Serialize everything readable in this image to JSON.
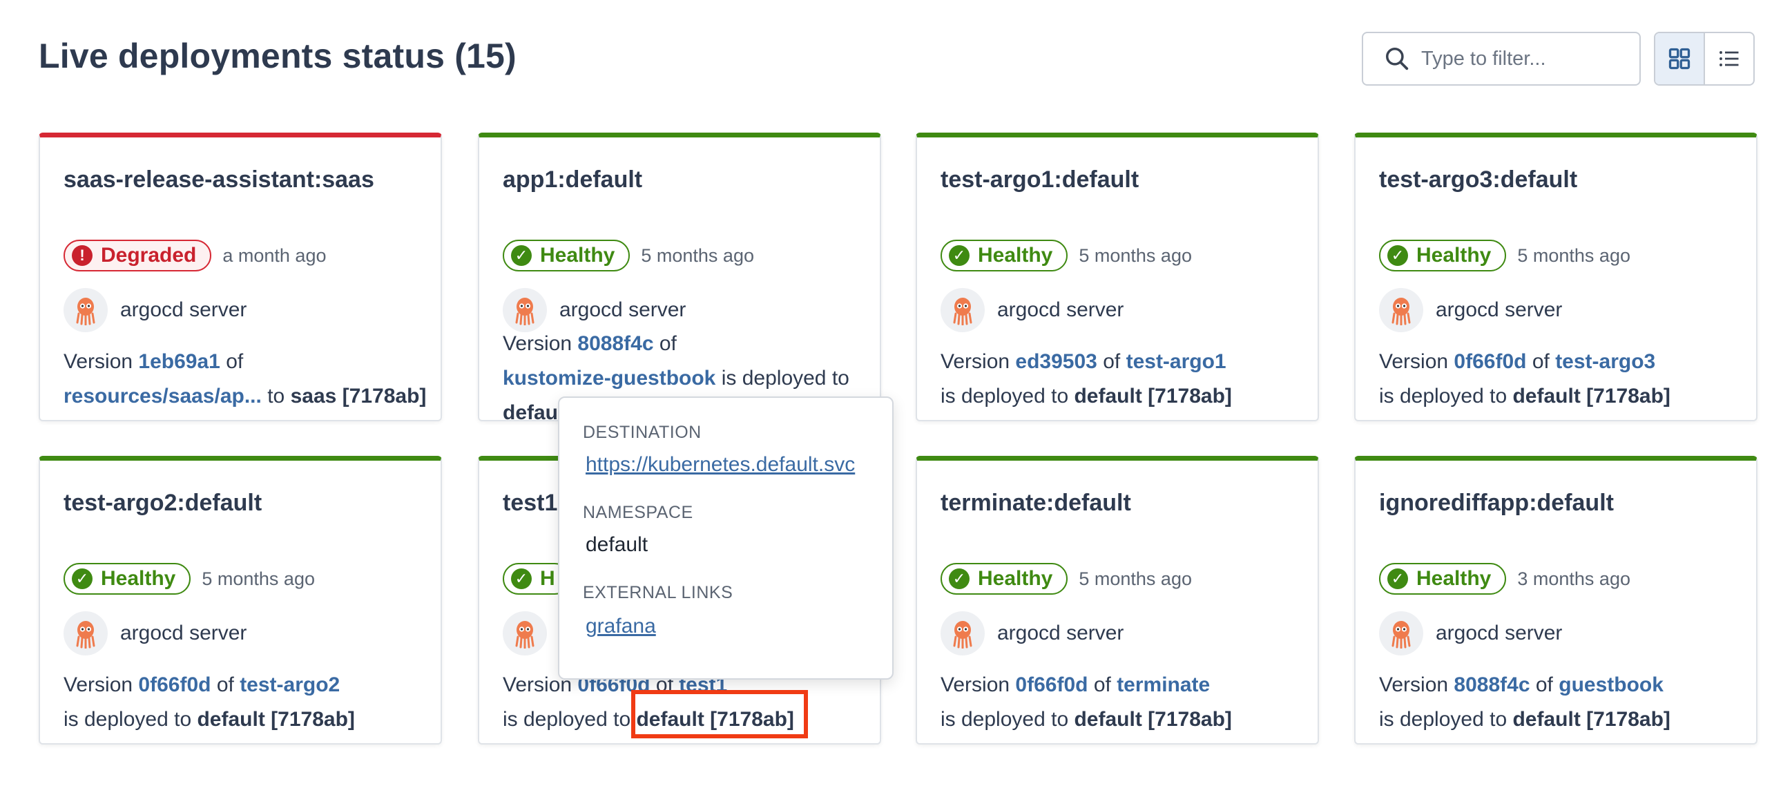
{
  "header": {
    "title": "Live deployments status (15)",
    "filter_placeholder": "Type to filter...",
    "view_grid_icon": "grid-view-icon",
    "view_list_icon": "list-view-icon"
  },
  "colors": {
    "healthy": "#3f8a12",
    "degraded": "#d62834",
    "link": "#3a6aa3",
    "highlight": "#f03b14"
  },
  "cards": [
    {
      "title": "saas-release-assistant:saas",
      "status": "Degraded",
      "time": "a month ago",
      "author": "argocd server",
      "version_prefix": "Version",
      "commit": "1eb69a1",
      "of": "of",
      "repo": "resources/saas/ap...",
      "deployed_text": "to",
      "target": "saas [7178ab]"
    },
    {
      "title": "app1:default",
      "status": "Healthy",
      "time": "5 months ago",
      "author": "argocd server",
      "version_prefix": "Version",
      "commit": "8088f4c",
      "of": "of",
      "repo": "kustomize-guestbook",
      "deployed_text": "is deployed to",
      "target": "default [7178ab]"
    },
    {
      "title": "test-argo1:default",
      "status": "Healthy",
      "time": "5 months ago",
      "author": "argocd server",
      "version_prefix": "Version",
      "commit": "ed39503",
      "of": "of",
      "repo": "test-argo1",
      "deployed_text": "is deployed to",
      "target": "default [7178ab]"
    },
    {
      "title": "test-argo3:default",
      "status": "Healthy",
      "time": "5 months ago",
      "author": "argocd server",
      "version_prefix": "Version",
      "commit": "0f66f0d",
      "of": "of",
      "repo": "test-argo3",
      "deployed_text": "is deployed to",
      "target": "default [7178ab]"
    },
    {
      "title": "test-argo2:default",
      "status": "Healthy",
      "time": "5 months ago",
      "author": "argocd server",
      "version_prefix": "Version",
      "commit": "0f66f0d",
      "of": "of",
      "repo": "test-argo2",
      "deployed_text": "is deployed to",
      "target": "default [7178ab]"
    },
    {
      "title": "test1",
      "status": "H",
      "time": "",
      "author": "",
      "version_prefix": "Version",
      "commit": "0f66f0d",
      "of": "of",
      "repo": "test1",
      "deployed_text": "is deployed to",
      "target": "default [7178ab]"
    },
    {
      "title": "terminate:default",
      "status": "Healthy",
      "time": "5 months ago",
      "author": "argocd server",
      "version_prefix": "Version",
      "commit": "0f66f0d",
      "of": "of",
      "repo": "terminate",
      "deployed_text": "is deployed to",
      "target": "default [7178ab]"
    },
    {
      "title": "ignorediffapp:default",
      "status": "Healthy",
      "time": "3 months ago",
      "author": "argocd server",
      "version_prefix": "Version",
      "commit": "8088f4c",
      "of": "of",
      "repo": "guestbook",
      "deployed_text": "is deployed to",
      "target": "default [7178ab]"
    }
  ],
  "popover": {
    "destination_label": "DESTINATION",
    "destination_value": "https://kubernetes.default.svc",
    "namespace_label": "NAMESPACE",
    "namespace_value": "default",
    "external_links_label": "EXTERNAL LINKS",
    "external_link": "grafana"
  }
}
